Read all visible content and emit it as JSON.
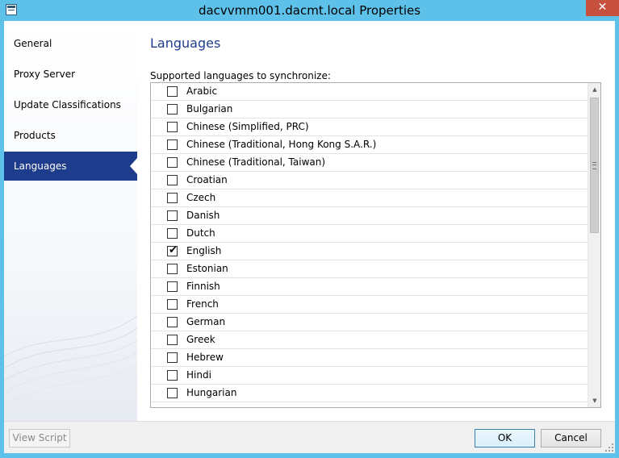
{
  "window": {
    "title": "dacvvmm001.dacmt.local Properties",
    "close_glyph": "✕"
  },
  "sidebar": {
    "items": [
      {
        "label": "General",
        "selected": false
      },
      {
        "label": "Proxy Server",
        "selected": false
      },
      {
        "label": "Update Classifications",
        "selected": false
      },
      {
        "label": "Products",
        "selected": false
      },
      {
        "label": "Languages",
        "selected": true
      }
    ]
  },
  "main": {
    "title": "Languages",
    "list_label": "Supported languages to synchronize:",
    "languages": [
      {
        "label": "Arabic",
        "checked": false
      },
      {
        "label": "Bulgarian",
        "checked": false
      },
      {
        "label": "Chinese (Simplified, PRC)",
        "checked": false
      },
      {
        "label": "Chinese (Traditional, Hong Kong S.A.R.)",
        "checked": false
      },
      {
        "label": "Chinese (Traditional, Taiwan)",
        "checked": false
      },
      {
        "label": "Croatian",
        "checked": false
      },
      {
        "label": "Czech",
        "checked": false
      },
      {
        "label": "Danish",
        "checked": false
      },
      {
        "label": "Dutch",
        "checked": false
      },
      {
        "label": "English",
        "checked": true
      },
      {
        "label": "Estonian",
        "checked": false
      },
      {
        "label": "Finnish",
        "checked": false
      },
      {
        "label": "French",
        "checked": false
      },
      {
        "label": "German",
        "checked": false
      },
      {
        "label": "Greek",
        "checked": false
      },
      {
        "label": "Hebrew",
        "checked": false
      },
      {
        "label": "Hindi",
        "checked": false
      },
      {
        "label": "Hungarian",
        "checked": false
      }
    ],
    "scrollbar": {
      "up_glyph": "▲",
      "down_glyph": "▼"
    }
  },
  "footer": {
    "view_script_label": "View Script",
    "ok_label": "OK",
    "cancel_label": "Cancel"
  },
  "colors": {
    "window_frame": "#5ec1ea",
    "accent": "#1e3c8c",
    "close_button": "#c7503c"
  }
}
